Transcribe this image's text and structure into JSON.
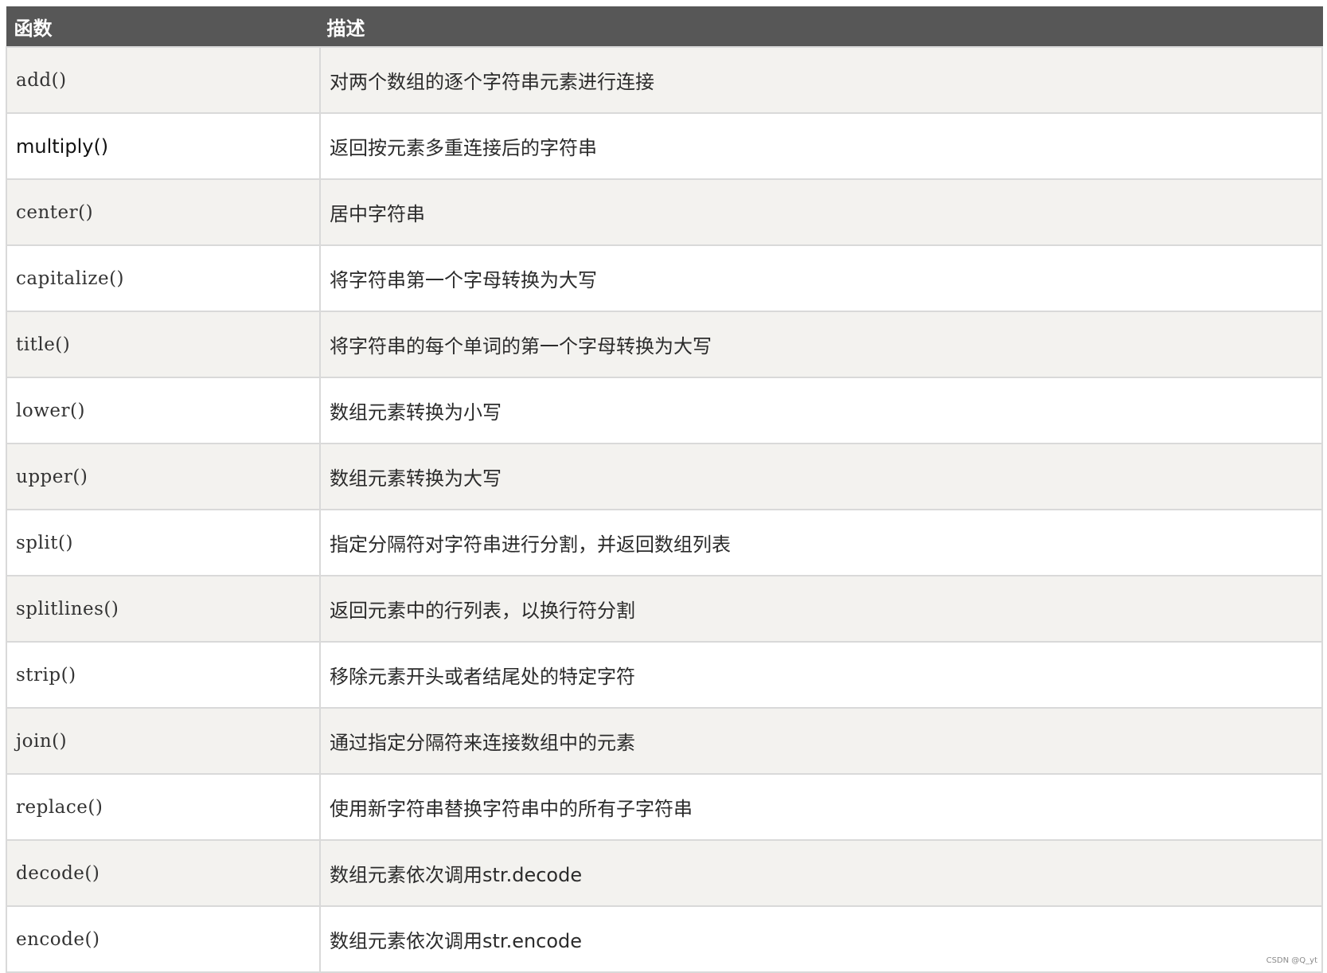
{
  "table": {
    "headers": [
      "函数",
      "描述"
    ],
    "rows": [
      {
        "fn": "add()",
        "desc": "对两个数组的逐个字符串元素进行连接"
      },
      {
        "fn": "multiply()",
        "desc": "返回按元素多重连接后的字符串"
      },
      {
        "fn": "center()",
        "desc": "居中字符串"
      },
      {
        "fn": "capitalize()",
        "desc": "将字符串第一个字母转换为大写"
      },
      {
        "fn": "title()",
        "desc": "将字符串的每个单词的第一个字母转换为大写"
      },
      {
        "fn": "lower()",
        "desc": "数组元素转换为小写"
      },
      {
        "fn": "upper()",
        "desc": "数组元素转换为大写"
      },
      {
        "fn": "split()",
        "desc": "指定分隔符对字符串进行分割，并返回数组列表"
      },
      {
        "fn": "splitlines()",
        "desc": "返回元素中的行列表，以换行符分割"
      },
      {
        "fn": "strip()",
        "desc": "移除元素开头或者结尾处的特定字符"
      },
      {
        "fn": "join()",
        "desc": "通过指定分隔符来连接数组中的元素"
      },
      {
        "fn": "replace()",
        "desc": "使用新字符串替换字符串中的所有子字符串"
      },
      {
        "fn": "decode()",
        "desc": "数组元素依次调用str.decode"
      },
      {
        "fn": "encode()",
        "desc": "数组元素依次调用str.encode"
      }
    ]
  },
  "watermark": "CSDN @Q_yt",
  "colors": {
    "header_bg": "#575757",
    "header_text": "#ffffff",
    "row_odd_bg": "#f3f2ef",
    "row_even_bg": "#ffffff",
    "border": "#d9d9d9"
  }
}
